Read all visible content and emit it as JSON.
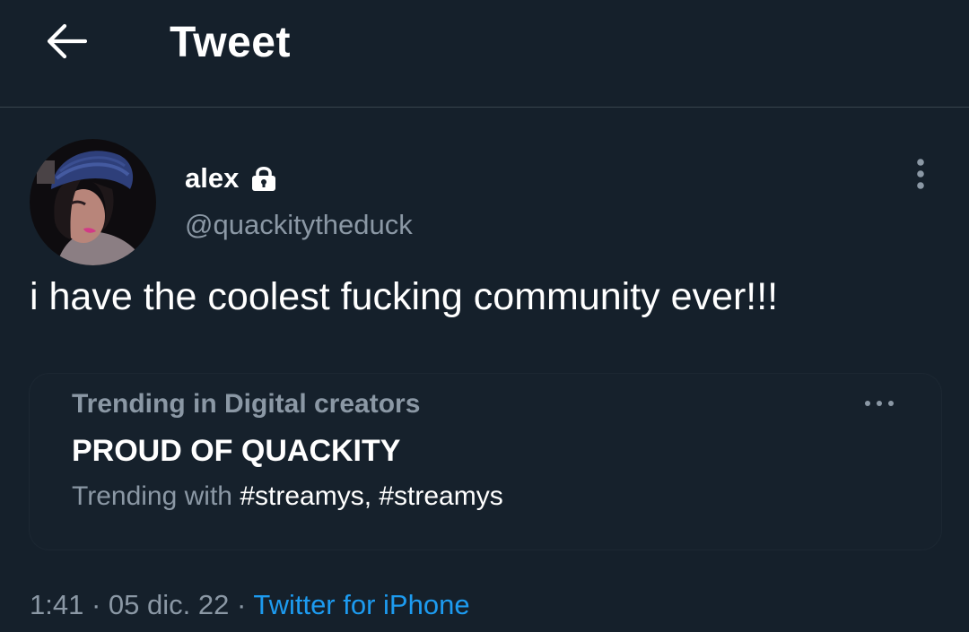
{
  "header": {
    "title": "Tweet",
    "back_icon": "arrow-left-icon"
  },
  "tweet": {
    "author": {
      "display_name": "alex",
      "handle": "@quackitytheduck",
      "protected_icon": "lock-icon"
    },
    "text": "i have the coolest fucking community ever!!!",
    "more_icon": "more-vertical-icon",
    "trend_card": {
      "context": "Trending in Digital creators",
      "name": "PROUD OF QUACKITY",
      "with_label": "Trending with",
      "hashtags": "#streamys, #streamys",
      "more_icon": "more-horizontal-icon"
    },
    "meta": {
      "time": "1:41",
      "separator": " · ",
      "date": "05 dic. 22",
      "source": "Twitter for iPhone"
    }
  },
  "colors": {
    "background": "#15202b",
    "border": "#38444d",
    "secondary_text": "#8b98a5",
    "link": "#1d9bf0"
  }
}
